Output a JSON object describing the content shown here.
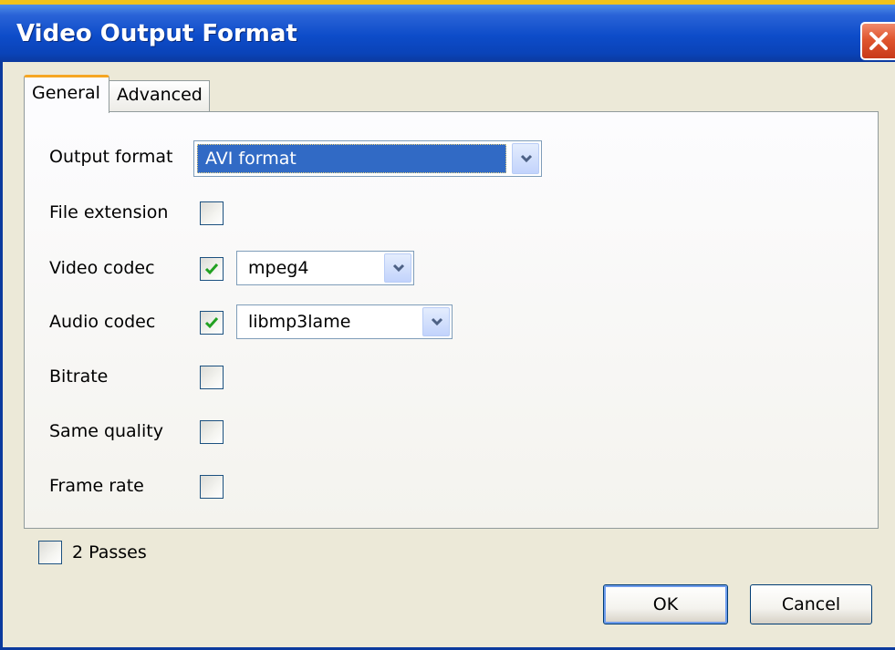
{
  "window": {
    "title": "Video Output Format",
    "close_icon": "close-icon"
  },
  "tabs": [
    {
      "label": "General",
      "selected": true
    },
    {
      "label": "Advanced",
      "selected": false
    }
  ],
  "form": {
    "output_format": {
      "label": "Output format",
      "value": "AVI format"
    },
    "file_extension": {
      "label": "File extension",
      "checked": false
    },
    "video_codec": {
      "label": "Video codec",
      "checked": true,
      "value": "mpeg4"
    },
    "audio_codec": {
      "label": "Audio codec",
      "checked": true,
      "value": "libmp3lame"
    },
    "bitrate": {
      "label": "Bitrate",
      "checked": false
    },
    "same_quality": {
      "label": "Same quality",
      "checked": false
    },
    "frame_rate": {
      "label": "Frame rate",
      "checked": false
    }
  },
  "two_passes": {
    "label": "2 Passes",
    "checked": false
  },
  "buttons": {
    "ok": "OK",
    "cancel": "Cancel"
  },
  "colors": {
    "titlebar": "#0d4cc9",
    "selection": "#316ac5",
    "check_green": "#21a121",
    "tab_accent": "#f5a623"
  }
}
